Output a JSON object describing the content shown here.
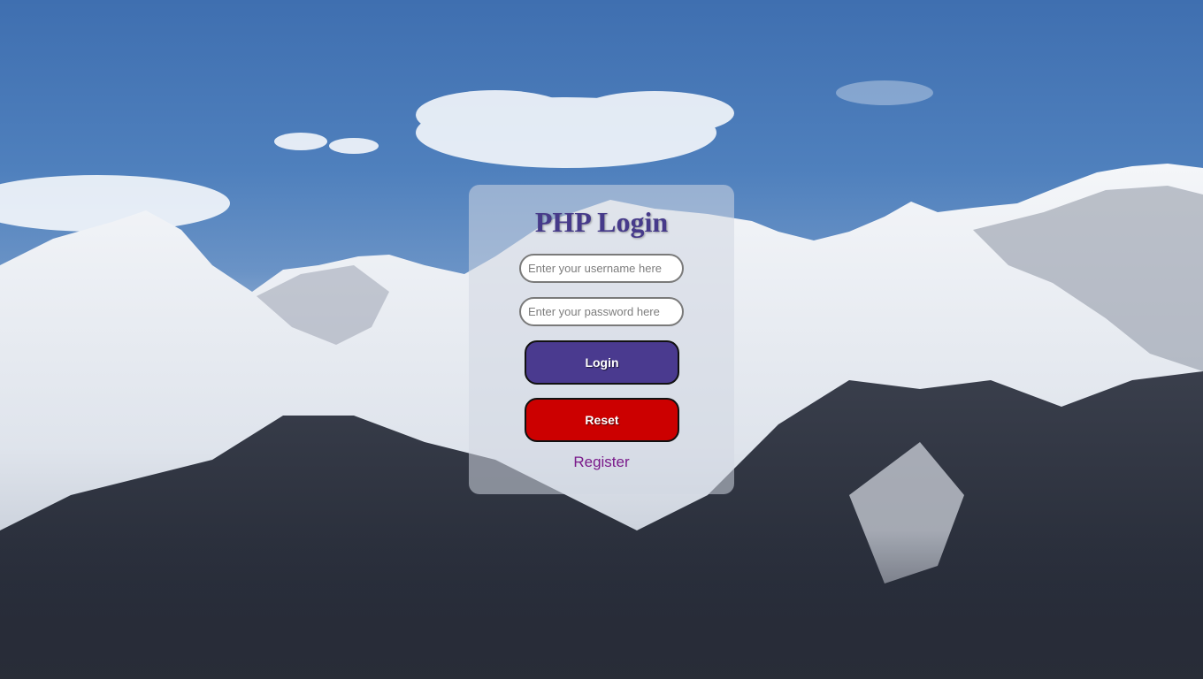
{
  "login_form": {
    "title": "PHP Login",
    "username_placeholder": "Enter your username here",
    "password_placeholder": "Enter your password here",
    "login_label": "Login",
    "reset_label": "Reset",
    "register_label": "Register"
  },
  "colors": {
    "title": "#463a8a",
    "login_button": "#4a3a8f",
    "reset_button": "#cc0000",
    "register_link": "#7a1a8a"
  },
  "background": {
    "image": "snow-capped-mountain-range-under-blue-sky"
  }
}
